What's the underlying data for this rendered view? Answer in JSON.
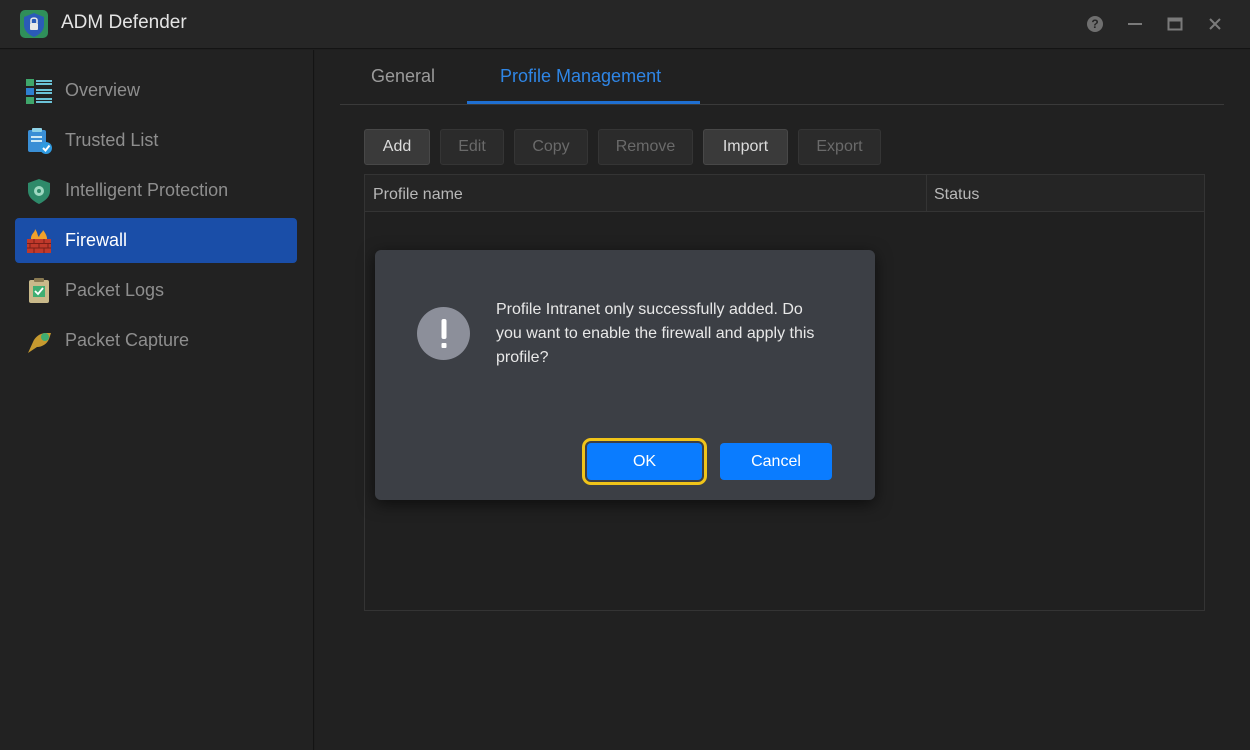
{
  "window": {
    "title": "ADM Defender",
    "controls": [
      "help-icon",
      "minimize-icon",
      "maximize-icon",
      "close-icon"
    ]
  },
  "sidebar": {
    "items": [
      {
        "label": "Overview",
        "icon": "overview-icon",
        "active": false
      },
      {
        "label": "Trusted List",
        "icon": "trusted-list-icon",
        "active": false
      },
      {
        "label": "Intelligent Protection",
        "icon": "shield-icon",
        "active": false
      },
      {
        "label": "Firewall",
        "icon": "firewall-icon",
        "active": true
      },
      {
        "label": "Packet Logs",
        "icon": "packet-logs-icon",
        "active": false
      },
      {
        "label": "Packet Capture",
        "icon": "packet-capture-icon",
        "active": false
      }
    ]
  },
  "tabs": [
    {
      "label": "General",
      "active": false
    },
    {
      "label": "Profile Management",
      "active": true
    }
  ],
  "toolbar": {
    "add": "Add",
    "edit": "Edit",
    "copy": "Copy",
    "remove": "Remove",
    "import": "Import",
    "export": "Export"
  },
  "table": {
    "columns": [
      "Profile name",
      "Status"
    ],
    "rows": []
  },
  "dialog": {
    "message": "Profile Intranet only successfully added. Do you want to enable the firewall and apply this profile?",
    "ok_label": "OK",
    "cancel_label": "Cancel",
    "icon": "exclamation-icon"
  },
  "colors": {
    "accent": "#0a7cff",
    "active_nav": "#1a4ea8",
    "active_tab": "#2f86e6",
    "focus_ring": "#f0c419"
  }
}
